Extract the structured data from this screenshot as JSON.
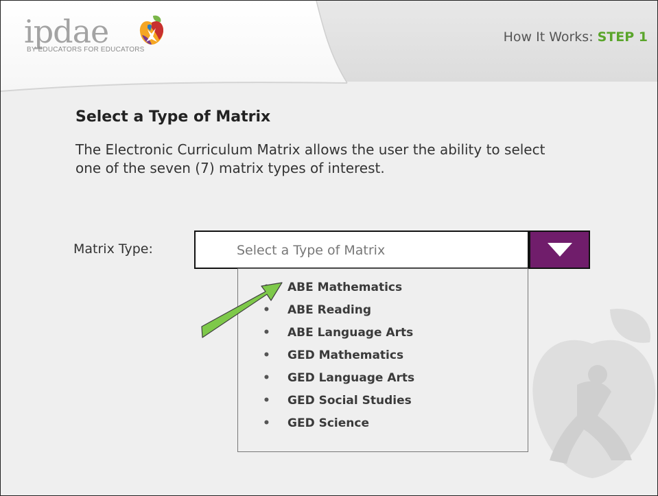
{
  "header": {
    "logo_word": "ipdae",
    "logo_tagline": "BY EDUCATORS FOR EDUCATORS",
    "step_prefix": "How It Works:",
    "step_label": "STEP 1"
  },
  "main": {
    "title": "Select a Type of Matrix",
    "description": "The Electronic Curriculum Matrix allows the user the ability to select one of the seven (7) matrix types of interest.",
    "matrix_label": "Matrix Type:",
    "select": {
      "placeholder": "Select a Type of Matrix",
      "button_icon": "triangle-down-icon"
    },
    "options": [
      "ABE Mathematics",
      "ABE Reading",
      "ABE Language Arts",
      "GED Mathematics",
      "GED Language Arts",
      "GED Social Studies",
      "GED Science"
    ]
  },
  "colors": {
    "accent_purple": "#701d6b",
    "step_green": "#5aa52b",
    "arrow_green": "#7ec94a"
  }
}
